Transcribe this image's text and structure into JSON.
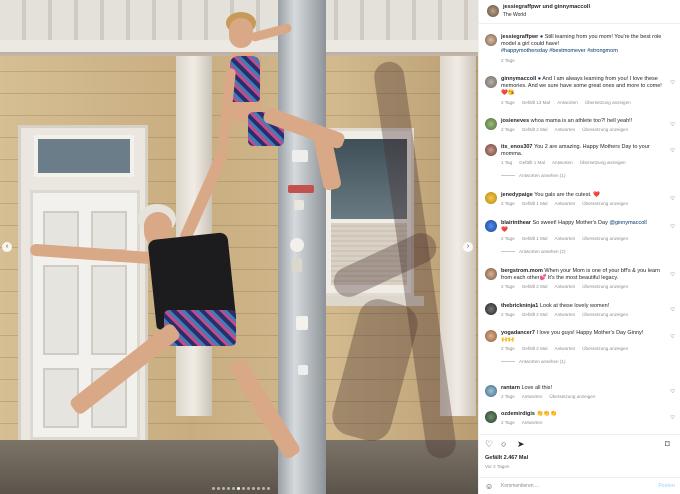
{
  "post": {
    "author_line": "jessiegraffpwr und ginnymaccoll",
    "location": "The World",
    "likes": "Gefällt 2.467 Mal",
    "date": "Vor 2 Tagen",
    "comment_placeholder": "Kommentieren ...",
    "post_label": "Posten"
  },
  "caption": {
    "user": "jessiegraffpwr",
    "text": "Still learning from you mom! You're the best role model a girl could have!",
    "hashtags": "#happymothersday #bestmomever #strongmom",
    "time": "2 Tage"
  },
  "comments": [
    {
      "user": "ginnymaccoll",
      "text": "And I am always learning from you! I love these memories. And we sure have some great ones and more to come!",
      "emoji": "❤️😘",
      "time": "2 Tage",
      "likes": "Gefällt 13 Mal",
      "reply": "Antworten",
      "translate": "Übersetzung anzeigen"
    },
    {
      "user": "josieneves",
      "text": "whoa mama is an athlete too?! hell yeah!!",
      "time": "2 Tage",
      "likes": "Gefällt 2 Mal",
      "reply": "Antworten",
      "translate": "Übersetzung anzeigen"
    },
    {
      "user": "its_enos307",
      "text": "You 2 are amazing. Happy Mothers Day to your momma.",
      "time": "1 Tag",
      "likes": "Gefällt 1 Mal",
      "reply": "Antworten",
      "translate": "Übersetzung anzeigen",
      "replies": "Antworten ansehen (1)"
    },
    {
      "user": "jenedypaige",
      "text": "You gals are the cutest.",
      "emoji": "❤️",
      "time": "2 Tage",
      "likes": "Gefällt 1 Mal",
      "reply": "Antworten",
      "translate": "Übersetzung anzeigen"
    },
    {
      "user": "blairinthear",
      "text": "So sweet! Happy Mother's Day",
      "mention": "@ginnymaccoll",
      "emoji": "❤️",
      "time": "2 Tage",
      "likes": "Gefällt 1 Mal",
      "reply": "Antworten",
      "translate": "Übersetzung anzeigen",
      "replies": "Antworten ansehen (2)"
    },
    {
      "user": "bergstrom.mom",
      "text": "When your Mom is one of your bff's & you learn from each other💕 It's the most beautiful legacy.",
      "time": "2 Tage",
      "likes": "Gefällt 2 Mal",
      "reply": "Antworten",
      "translate": "Übersetzung anzeigen"
    },
    {
      "user": "thebrickninja1",
      "text": "Look at these lovely women!",
      "time": "2 Tage",
      "likes": "Gefällt 2 Mal",
      "reply": "Antworten",
      "translate": "Übersetzung anzeigen"
    },
    {
      "user": "yogadancer7",
      "text": "I love you guys! Happy Mother's Day Ginny!",
      "emoji": "🙌🙌",
      "time": "2 Tage",
      "likes": "Gefällt 2 Mal",
      "reply": "Antworten",
      "translate": "Übersetzung anzeigen",
      "replies": "Antworten ansehen (1)"
    },
    {
      "user": "rantarn",
      "text": "Love all this!",
      "time": "2 Tage",
      "reply": "Antworten",
      "translate": "Übersetzung anzeigen"
    },
    {
      "user": "ozdemirdigis",
      "text": "",
      "emoji": "👏👏👏",
      "time": "2 Tage",
      "reply": "Antworten"
    }
  ],
  "icons": {
    "like": "heart-icon",
    "comment": "comment-icon",
    "share": "share-icon",
    "save": "bookmark-icon",
    "more": "more-icon",
    "prev": "chevron-left-icon",
    "next": "chevron-right-icon",
    "emoji": "emoji-icon"
  },
  "colors": {
    "link": "#00376b",
    "muted": "#8e8e8e",
    "like_red": "#ed4956",
    "post_btn": "#b3dbff"
  }
}
